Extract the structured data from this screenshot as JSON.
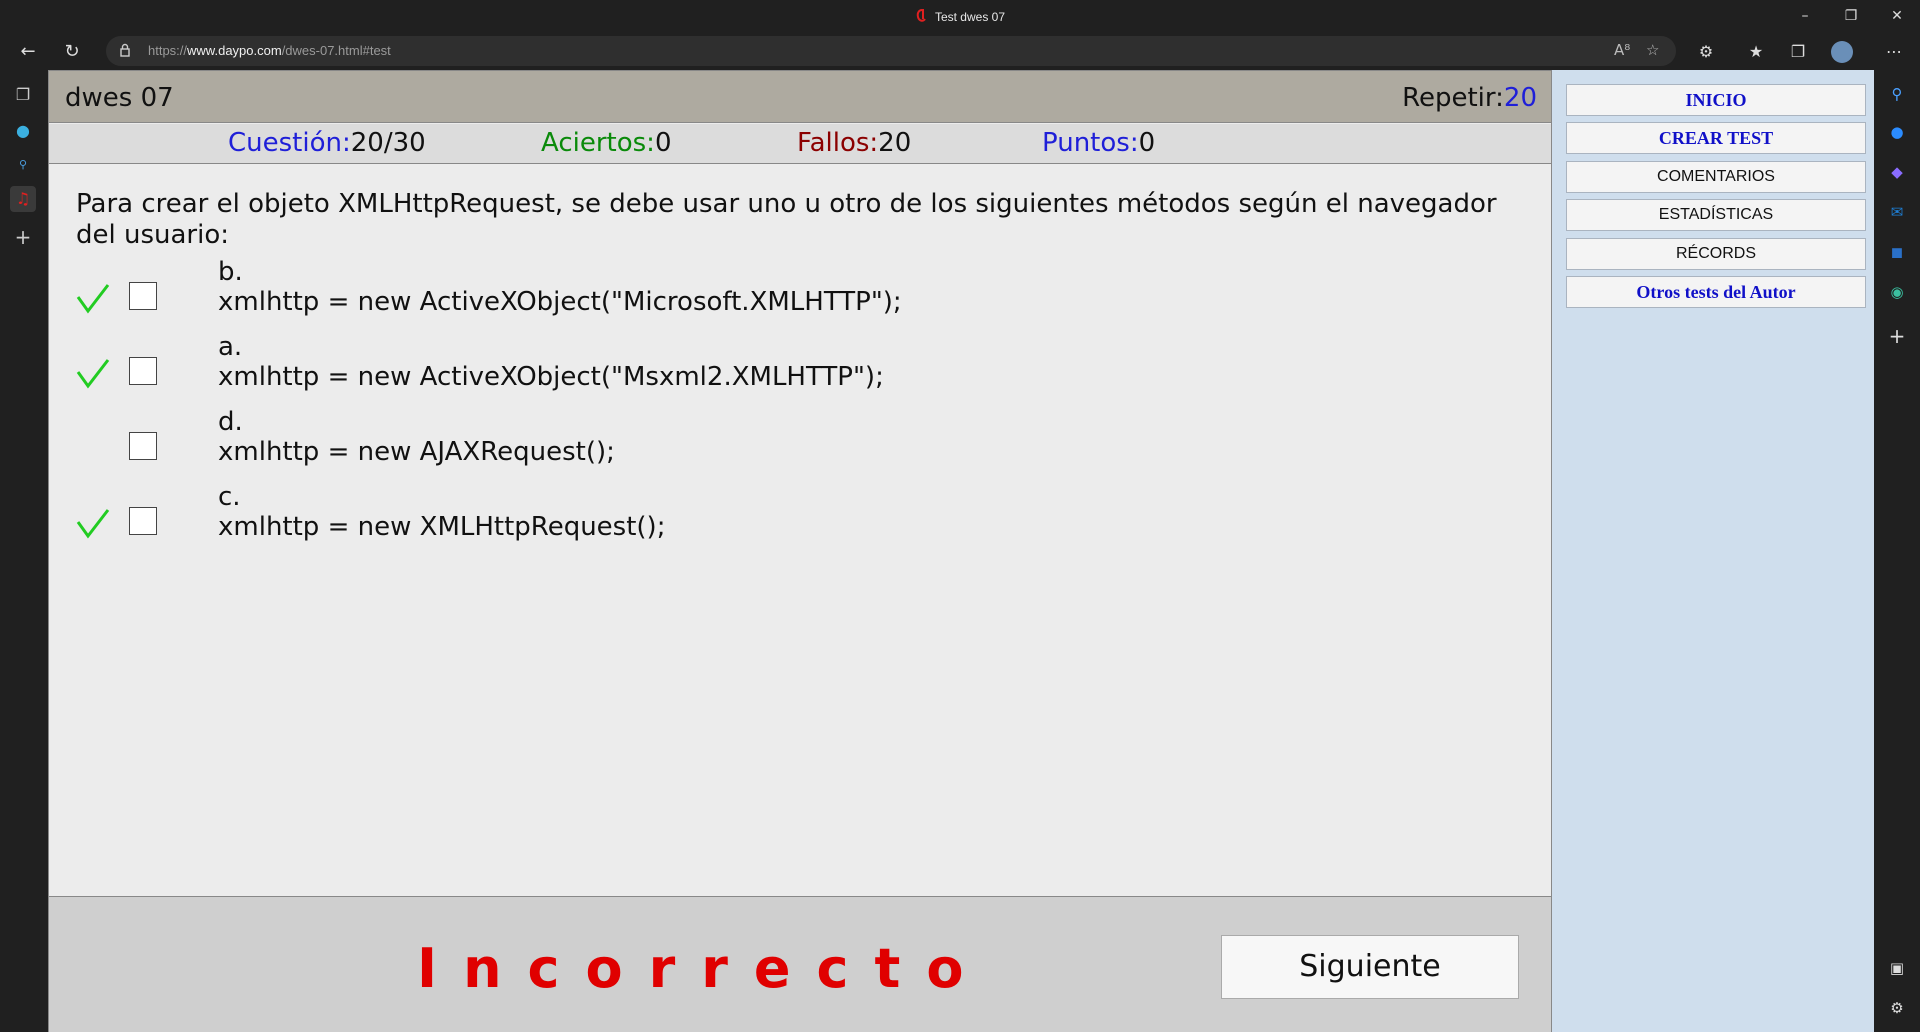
{
  "browser": {
    "window_title": "Test dwes 07",
    "url_prefix": "https://",
    "url_domain": "www.daypo.com",
    "url_path": "/dwes-07.html#test",
    "read_aloud_label": "A⁸"
  },
  "header": {
    "test_name": "dwes 07",
    "repeat_label": "Repetir:",
    "repeat_value": "20"
  },
  "stats": {
    "question_label": "Cuestión:",
    "question_value": "20/30",
    "correct_label": "Aciertos:",
    "correct_value": "0",
    "wrong_label": "Fallos:",
    "wrong_value": "20",
    "points_label": "Puntos:",
    "points_value": "0"
  },
  "question": {
    "text": "Para crear el objeto XMLHttpRequest, se debe usar uno u otro de los siguientes métodos según el navegador del usuario:",
    "options": [
      {
        "letter": "b.",
        "text": "xmlhttp = new ActiveXObject(\"Microsoft.XMLHTTP\");",
        "correct": true
      },
      {
        "letter": "a.",
        "text": "xmlhttp = new ActiveXObject(\"Msxml2.XMLHTTP\");",
        "correct": true
      },
      {
        "letter": "d.",
        "text": "xmlhttp = new AJAXRequest();",
        "correct": false
      },
      {
        "letter": "c.",
        "text": "xmlhttp = new XMLHttpRequest();",
        "correct": true
      }
    ]
  },
  "footer": {
    "result_text": "Incorrecto",
    "next_label": "Siguiente"
  },
  "sidemenu": {
    "inicio": "INICIO",
    "crear_test": "CREAR TEST",
    "comentarios": "COMENTARIOS",
    "estadisticas": "ESTADÍSTICAS",
    "records": "RÉCORDS",
    "otros_tests": "Otros tests del Autor"
  },
  "colors": {
    "question_label": "#1f1fd8",
    "correct_label": "#0a8a0a",
    "wrong_label": "#8b0000",
    "points_label": "#1f1fd8",
    "result": "#e00000",
    "checkmark": "#22cc22"
  }
}
